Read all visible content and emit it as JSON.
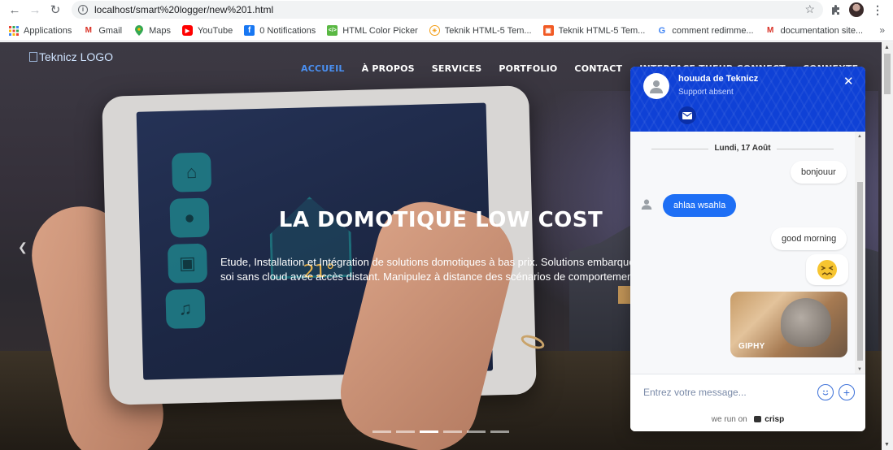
{
  "browser": {
    "url": "localhost/smart%20logger/new%201.html",
    "bookmarks": [
      {
        "label": "Applications",
        "icon": "apps-grid-icon"
      },
      {
        "label": "Gmail",
        "icon": "gmail-icon"
      },
      {
        "label": "Maps",
        "icon": "maps-pin-icon"
      },
      {
        "label": "YouTube",
        "icon": "youtube-icon"
      },
      {
        "label": "0 Notifications",
        "icon": "facebook-icon"
      },
      {
        "label": "HTML Color Picker",
        "icon": "color-picker-icon"
      },
      {
        "label": "Teknik HTML-5 Tem...",
        "icon": "teknik-icon"
      },
      {
        "label": "Teknik HTML-5 Tem...",
        "icon": "teknik-icon"
      },
      {
        "label": "comment redimme...",
        "icon": "google-icon"
      },
      {
        "label": "documentation site...",
        "icon": "gmail-icon"
      }
    ]
  },
  "site": {
    "logo_alt": "Teknicz LOGO",
    "menu": [
      {
        "label": "ACCUEIL",
        "active": true
      },
      {
        "label": "À PROPOS",
        "active": false
      },
      {
        "label": "SERVICES",
        "active": false
      },
      {
        "label": "PORTFOLIO",
        "active": false
      },
      {
        "label": "CONTACT",
        "active": false
      },
      {
        "label": "INTERFACE TUEUR CONNECT",
        "active": false
      },
      {
        "label": "CONNEXTE",
        "active": false
      }
    ],
    "hero": {
      "title": "LA DOMOTIQUE LOW COST",
      "text_line1": "Etude, Installation et Intégration de solutions domotiques à bas prix. Solutions embarquées",
      "text_line2": "soi sans cloud avec accès distant. Manipulez à distance des scénarios de comportement hu",
      "tablet_temp": "21°"
    },
    "carousel": {
      "count": 6,
      "active_index": 2
    }
  },
  "chat": {
    "agent_name": "houuda de Teknicz",
    "agent_status": "Support absent",
    "date": "Lundi, 17 Août",
    "messages": [
      {
        "from": "user",
        "text": "bonjouur"
      },
      {
        "from": "agent",
        "text": "ahlaa wsahla"
      },
      {
        "from": "user",
        "text": "good morning"
      },
      {
        "from": "user",
        "type": "emoji",
        "text": "😖"
      },
      {
        "from": "user",
        "type": "gif",
        "text": "GIPHY"
      }
    ],
    "input_placeholder": "Entrez votre message...",
    "footer_prefix": "we run on",
    "footer_brand": "crisp",
    "accent": "#0f41d6"
  }
}
